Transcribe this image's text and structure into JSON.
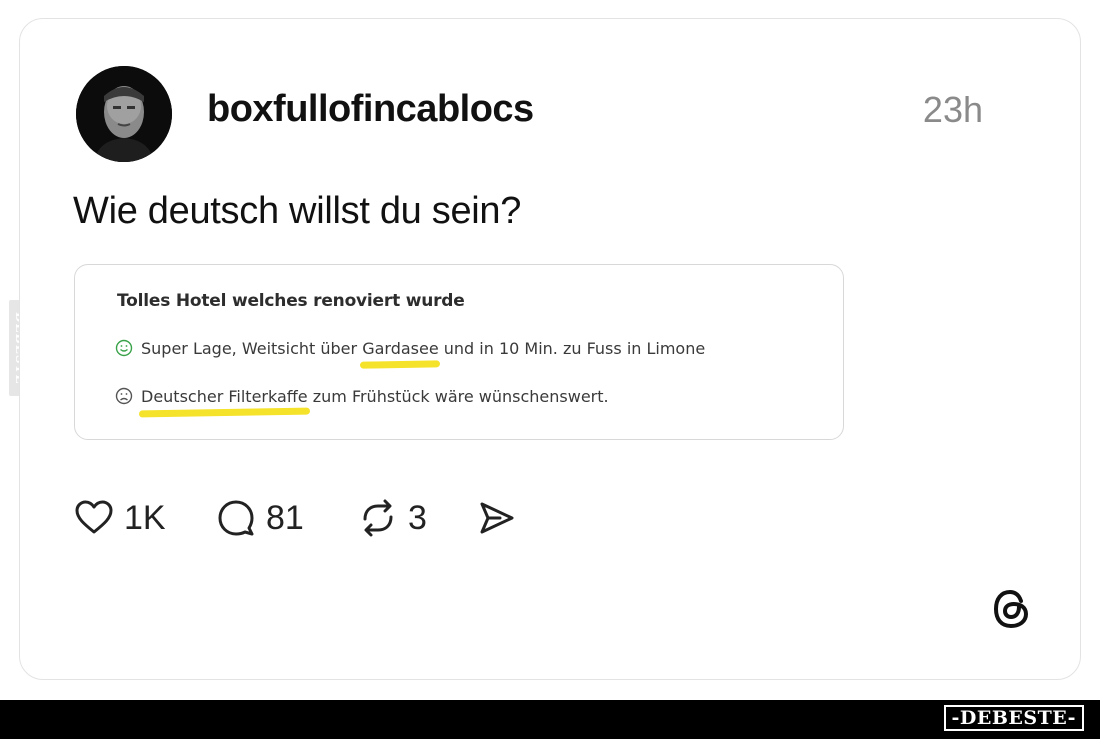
{
  "watermark": {
    "side_text": "DEBESTE",
    "footer_text": "-DEBESTE-"
  },
  "post": {
    "username": "boxfullofincablocs",
    "time": "23h",
    "text": "Wie deutsch willst du sein?",
    "avatar_icon": "profile-photo"
  },
  "review": {
    "title": "Tolles Hotel welches renoviert wurde",
    "positive": {
      "icon": "smiley-face-icon",
      "before": "Super Lage, Weitsicht über ",
      "highlight": "Gardasee",
      "after": " und in 10 Min. zu Fuss in Limone"
    },
    "negative": {
      "icon": "sad-face-icon",
      "highlight": "Deutscher Filterkaffe",
      "after": " zum Frühstück wäre wünschenswert."
    },
    "highlight_color": "#f5e22a"
  },
  "actions": {
    "likes": "1K",
    "comments": "81",
    "reposts": "3"
  }
}
